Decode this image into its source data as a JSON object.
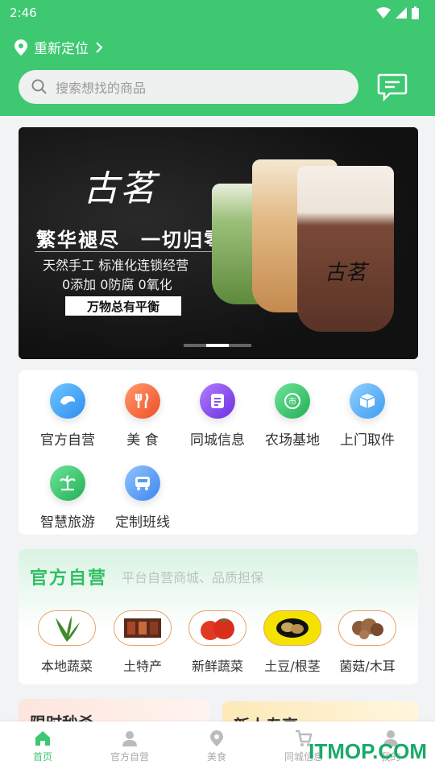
{
  "status": {
    "time": "2:46"
  },
  "header": {
    "location_label": "重新定位",
    "search_placeholder": "搜索想找的商品"
  },
  "banner": {
    "brand": "古茗",
    "slogan": "繁华褪尽　一切归零",
    "line1": "天然手工 标准化连锁经营",
    "line2": "0添加 0防腐 0氧化",
    "tag": "万物总有平衡",
    "cup_text": "古茗"
  },
  "categories": [
    {
      "label": "官方自营",
      "icon": "shrimp-icon",
      "color": "#3ea6f5"
    },
    {
      "label": "美 食",
      "icon": "fork-knife-icon",
      "color": "#f56a3e"
    },
    {
      "label": "同城信息",
      "icon": "document-icon",
      "color": "#8a4ef0"
    },
    {
      "label": "农场基地",
      "icon": "market-icon",
      "color": "#36c46b"
    },
    {
      "label": "上门取件",
      "icon": "package-icon",
      "color": "#4fb0f2"
    },
    {
      "label": "智慧旅游",
      "icon": "palm-tree-icon",
      "color": "#33c767"
    },
    {
      "label": "定制班线",
      "icon": "bus-icon",
      "color": "#4f9cf2"
    }
  ],
  "self_operated": {
    "title": "官方自营",
    "subtitle": "平台自营商城、品质担保",
    "items": [
      {
        "label": "本地蔬菜"
      },
      {
        "label": "土特产"
      },
      {
        "label": "新鲜蔬菜"
      },
      {
        "label": "土豆/根茎"
      },
      {
        "label": "菌菇/木耳"
      }
    ]
  },
  "promos": {
    "flash_sale": "限时秒杀",
    "new_arrivals": "新人专享"
  },
  "tabbar": [
    {
      "label": "首页",
      "icon": "home-icon",
      "active": true
    },
    {
      "label": "官方自营",
      "icon": "user-pin-icon",
      "active": false
    },
    {
      "label": "美食",
      "icon": "location-icon",
      "active": false
    },
    {
      "label": "同城信息",
      "icon": "cart-icon",
      "active": false
    },
    {
      "label": "我的",
      "icon": "profile-icon",
      "active": false
    }
  ],
  "watermark": "ITMOP.COM"
}
